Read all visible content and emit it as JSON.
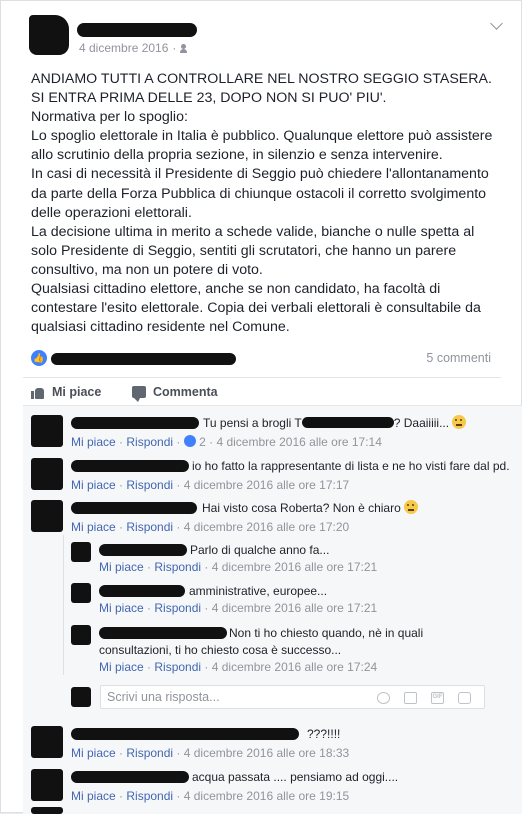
{
  "post": {
    "date": "4 dicembre 2016",
    "text_lines": [
      "ANDIAMO TUTTI A CONTROLLARE NEL NOSTRO SEGGIO STASERA.",
      "SI ENTRA PRIMA DELLE 23, DOPO NON SI PUO' PIU'.",
      "Normativa per lo spoglio:",
      "Lo spoglio elettorale in Italia è pubblico. Qualunque elettore può assistere",
      "allo scrutinio della propria sezione, in silenzio e senza intervenire.",
      "In casi di necessità il Presidente di Seggio può chiedere l'allontanamento",
      "da parte della Forza Pubblica di chiunque ostacoli il corretto svolgimento",
      "delle operazioni elettorali.",
      "La decisione ultima in merito a schede valide, bianche o nulle spetta al",
      "solo Presidente di Seggio, sentiti gli scrutatori, che hanno un parere",
      "consultivo, ma non un potere di voto.",
      "Qualsiasi cittadino elettore, anche se non candidato, ha facoltà di",
      "contestare l'esito elettorale. Copia dei verbali elettorali è consultabile da",
      "qualsiasi cittadino residente nel Comune."
    ],
    "comments_count": "5 commenti"
  },
  "actions": {
    "like": "Mi piace",
    "comment": "Commenta"
  },
  "comment_labels": {
    "like": "Mi piace",
    "reply": "Rispondi",
    "sep": " · "
  },
  "comments": [
    {
      "text_a": "Tu pensi a brogli T",
      "text_b": "? Daaiiiii...",
      "likes": "2",
      "time": "4 dicembre 2016 alle ore 17:14"
    },
    {
      "text_a": "io ho fatto la rappresentante di lista e ne ho visti fare dal pd.",
      "time": "4 dicembre 2016 alle ore 17:17"
    },
    {
      "text_a": "Hai visto cosa Roberta? Non è chiaro",
      "time": "4 dicembre 2016 alle ore 17:20"
    },
    {
      "text_a": "Parlo di qualche anno fa...",
      "time": "4 dicembre 2016 alle ore 17:21"
    },
    {
      "text_a": "amministrative, europee...",
      "time": "4 dicembre 2016 alle ore 17:21"
    },
    {
      "text_a": "Non ti ho chiesto quando, nè in quali",
      "text_b": "consultazioni, ti ho chiesto cosa è successo...",
      "time": "4 dicembre 2016 alle ore 17:24"
    },
    {
      "text_a": "???!!!!",
      "time": "4 dicembre 2016 alle ore 18:33"
    },
    {
      "text_a": "acqua passata .... pensiamo ad oggi....",
      "time": "4 dicembre 2016 alle ore 19:15"
    }
  ],
  "reply": {
    "placeholder": "Scrivi una risposta..."
  }
}
